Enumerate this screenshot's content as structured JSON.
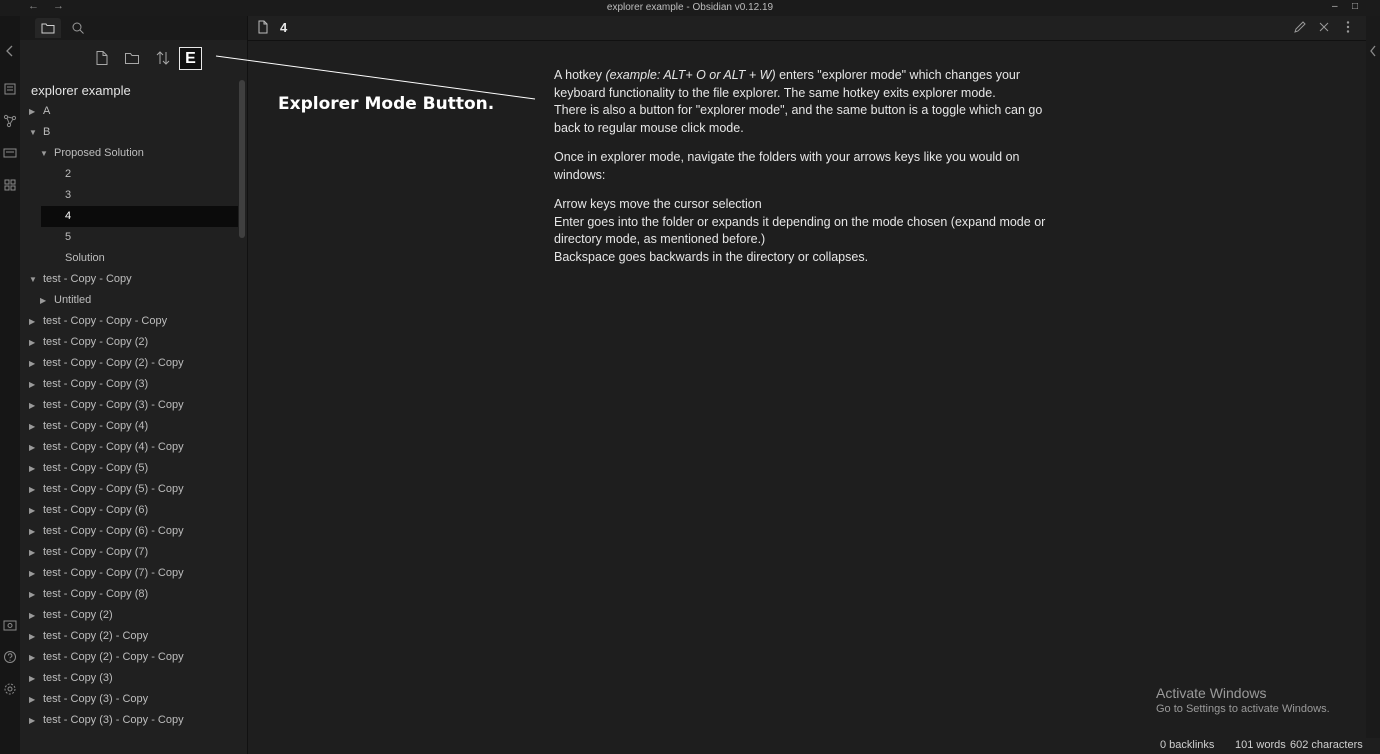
{
  "window": {
    "title": "explorer example - Obsidian v0.12.19",
    "back_glyph": "←",
    "forward_glyph": "→",
    "minimize_glyph": "–",
    "maximize_glyph": "□"
  },
  "explorer": {
    "vault_name": "explorer example",
    "explorer_mode_button_label": "E",
    "tree": [
      {
        "label": "A",
        "depth": 0,
        "caret": "▶"
      },
      {
        "label": "B",
        "depth": 0,
        "caret": "▼"
      },
      {
        "label": "Proposed Solution",
        "depth": 1,
        "caret": "▼"
      },
      {
        "label": "2",
        "depth": 2,
        "caret": ""
      },
      {
        "label": "3",
        "depth": 2,
        "caret": ""
      },
      {
        "label": "4",
        "depth": 2,
        "caret": "",
        "selected": true
      },
      {
        "label": "5",
        "depth": 2,
        "caret": ""
      },
      {
        "label": "Solution",
        "depth": 2,
        "caret": ""
      },
      {
        "label": "test - Copy - Copy",
        "depth": 0,
        "caret": "▼"
      },
      {
        "label": "Untitled",
        "depth": 1,
        "caret": "▶"
      },
      {
        "label": "test - Copy - Copy - Copy",
        "depth": 0,
        "caret": "▶"
      },
      {
        "label": "test - Copy - Copy (2)",
        "depth": 0,
        "caret": "▶"
      },
      {
        "label": "test - Copy - Copy (2) - Copy",
        "depth": 0,
        "caret": "▶"
      },
      {
        "label": "test - Copy - Copy (3)",
        "depth": 0,
        "caret": "▶"
      },
      {
        "label": "test - Copy - Copy (3) - Copy",
        "depth": 0,
        "caret": "▶"
      },
      {
        "label": "test - Copy - Copy (4)",
        "depth": 0,
        "caret": "▶"
      },
      {
        "label": "test - Copy - Copy (4) - Copy",
        "depth": 0,
        "caret": "▶"
      },
      {
        "label": "test - Copy - Copy (5)",
        "depth": 0,
        "caret": "▶"
      },
      {
        "label": "test - Copy - Copy (5) - Copy",
        "depth": 0,
        "caret": "▶"
      },
      {
        "label": "test - Copy - Copy (6)",
        "depth": 0,
        "caret": "▶"
      },
      {
        "label": "test - Copy - Copy (6) - Copy",
        "depth": 0,
        "caret": "▶"
      },
      {
        "label": "test - Copy - Copy (7)",
        "depth": 0,
        "caret": "▶"
      },
      {
        "label": "test - Copy - Copy (7) - Copy",
        "depth": 0,
        "caret": "▶"
      },
      {
        "label": "test - Copy - Copy (8)",
        "depth": 0,
        "caret": "▶"
      },
      {
        "label": "test - Copy (2)",
        "depth": 0,
        "caret": "▶"
      },
      {
        "label": "test - Copy (2) - Copy",
        "depth": 0,
        "caret": "▶"
      },
      {
        "label": "test - Copy (2) - Copy - Copy",
        "depth": 0,
        "caret": "▶"
      },
      {
        "label": "test - Copy (3)",
        "depth": 0,
        "caret": "▶"
      },
      {
        "label": "test - Copy (3) - Copy",
        "depth": 0,
        "caret": "▶"
      },
      {
        "label": "test - Copy (3) - Copy - Copy",
        "depth": 0,
        "caret": "▶"
      }
    ]
  },
  "editor": {
    "tab_title": "4",
    "annotation": "Explorer Mode Button.",
    "p1_pre": "A hotkey ",
    "p1_em": "(example: ALT+ O or ALT + W)",
    "p1_post": " enters \"explorer mode\" which changes your keyboard functionality to the file explorer. The same hotkey exits explorer mode.",
    "p1_line2": "There is also a button for \"explorer mode\", and the same button is a toggle which can go back to regular mouse click mode.",
    "p2": "Once in explorer mode, navigate the folders with your arrows keys like you would on windows:",
    "p3_l1": "Arrow keys move the cursor selection",
    "p3_l2": "Enter goes into the folder or expands it depending on the mode chosen (expand mode or directory mode, as mentioned before.)",
    "p3_l3": "Backspace goes backwards in the directory or collapses."
  },
  "status": {
    "backlinks": "0 backlinks",
    "words": "101 words",
    "characters": "602 characters"
  },
  "watermark": {
    "line1": "Activate Windows",
    "line2": "Go to Settings to activate Windows."
  }
}
